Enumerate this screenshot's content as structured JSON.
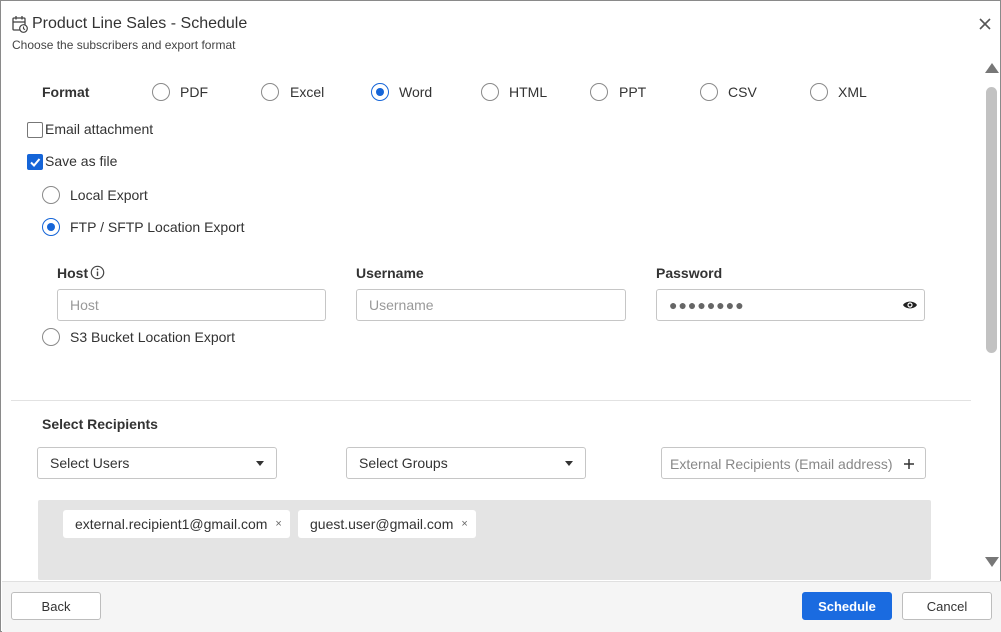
{
  "dialog": {
    "title": "Product Line Sales - Schedule",
    "subtitle": "Choose the subscribers and export format",
    "title_icon": "calendar-clock-icon",
    "close_icon": "close-icon"
  },
  "format": {
    "label": "Format",
    "options": [
      {
        "label": "PDF",
        "selected": false
      },
      {
        "label": "Excel",
        "selected": false
      },
      {
        "label": "Word",
        "selected": true
      },
      {
        "label": "HTML",
        "selected": false
      },
      {
        "label": "PPT",
        "selected": false
      },
      {
        "label": "CSV",
        "selected": false
      },
      {
        "label": "XML",
        "selected": false
      }
    ]
  },
  "delivery": {
    "email_attachment": {
      "label": "Email attachment",
      "checked": false
    },
    "save_as_file": {
      "label": "Save as file",
      "checked": true
    },
    "save_options": [
      {
        "label": "Local Export",
        "selected": false
      },
      {
        "label": "FTP / SFTP Location Export",
        "selected": true
      },
      {
        "label": "S3 Bucket Location Export",
        "selected": false
      }
    ]
  },
  "ftp": {
    "host_label": "Host",
    "host_info_icon": "info-icon",
    "host_placeholder": "Host",
    "username_label": "Username",
    "username_placeholder": "Username",
    "password_label": "Password",
    "password_value": "●●●●●●●●",
    "password_toggle_icon": "eye-icon"
  },
  "recipients": {
    "label": "Select Recipients",
    "users_select": "Select Users",
    "groups_select": "Select Groups",
    "external_placeholder": "External Recipients (Email address)",
    "add_icon": "plus-icon",
    "chips": [
      {
        "email": "external.recipient1@gmail.com"
      },
      {
        "email": "guest.user@gmail.com"
      }
    ],
    "chip_remove": "×"
  },
  "footer": {
    "back_label": "Back",
    "schedule_label": "Schedule",
    "cancel_label": "Cancel"
  },
  "colors": {
    "accent": "#1a6be0",
    "recipients_bg": "#e4e4e4",
    "footer_bg": "#f5f5f5"
  }
}
